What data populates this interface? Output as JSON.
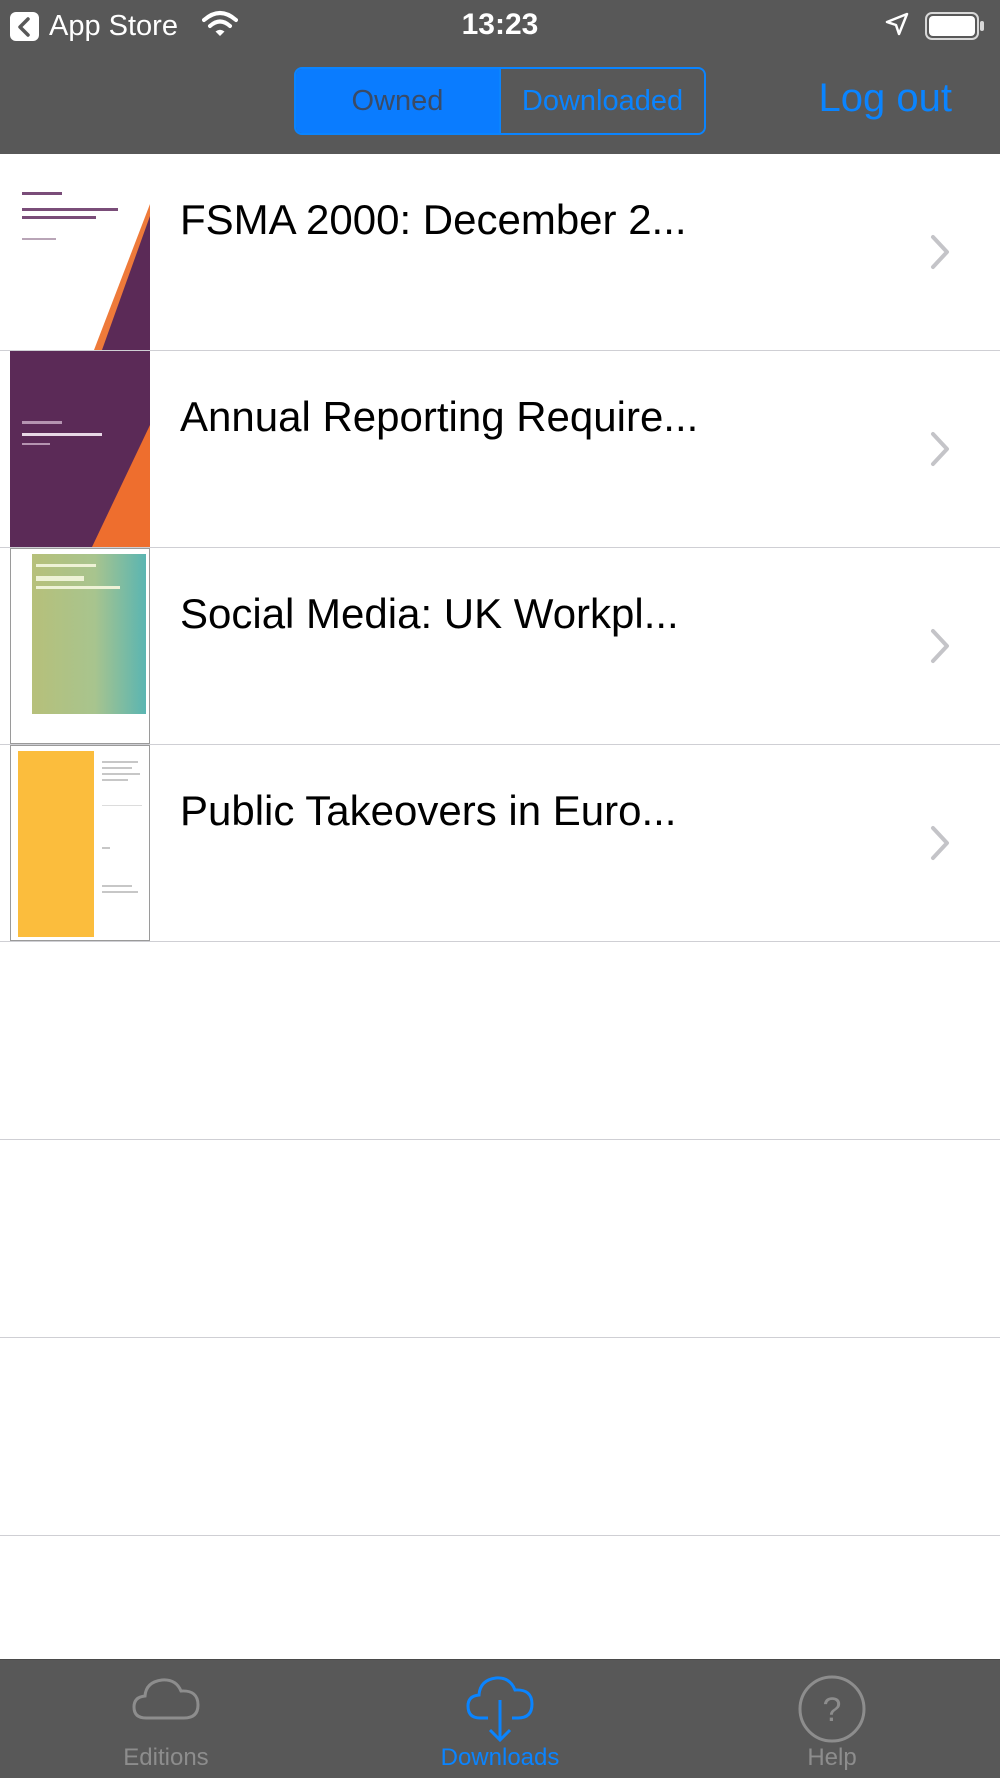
{
  "status_bar": {
    "back_app": "App Store",
    "time": "13:23"
  },
  "nav": {
    "segments": [
      "Owned",
      "Downloaded"
    ],
    "selected_segment": "Owned",
    "logout_label": "Log out"
  },
  "list": {
    "items": [
      {
        "title": "FSMA 2000: December 2...",
        "cover": "fsma-cover"
      },
      {
        "title": "Annual Reporting Require...",
        "cover": "annual-reporting-cover"
      },
      {
        "title": "Social Media: UK Workpl...",
        "cover": "social-media-cover"
      },
      {
        "title": "Public Takeovers in Euro...",
        "cover": "public-takeovers-cover"
      }
    ]
  },
  "tab_bar": {
    "tabs": [
      {
        "label": "Editions",
        "icon": "cloud-icon",
        "active": false
      },
      {
        "label": "Downloads",
        "icon": "cloud-download-icon",
        "active": true
      },
      {
        "label": "Help",
        "icon": "help-icon",
        "active": false
      }
    ]
  },
  "colors": {
    "bar_background": "#585858",
    "accent": "#0a84ff",
    "separator": "#cfcfd4"
  }
}
